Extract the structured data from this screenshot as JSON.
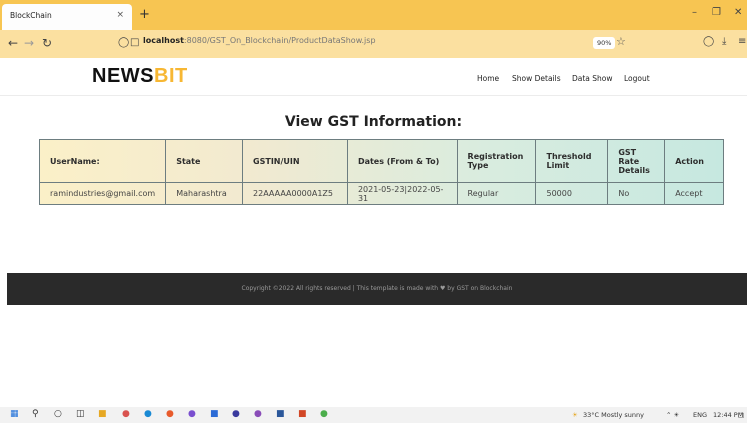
{
  "browser": {
    "tab_title": "BlockChain",
    "tab_close": "×",
    "new_tab": "+",
    "url_prefix": "localhost",
    "url_path": ":8080/GST_On_Blockchain/ProductDataShow.jsp",
    "zoom": "90%",
    "icons": [
      "back-icon",
      "forward-icon",
      "reload-icon",
      "shield-icon",
      "page-icon",
      "star-icon",
      "pocket-icon",
      "download-icon",
      "menu-icon"
    ]
  },
  "site": {
    "logo_main": "NEWS",
    "logo_accent": "BIT",
    "accent_color": "#f7b733",
    "nav": [
      "Home",
      "Show Details",
      "Data Show",
      "Logout"
    ]
  },
  "page": {
    "title": "View GST Information:"
  },
  "table": {
    "headers": [
      "UserName:",
      "State",
      "GSTIN/UIN",
      "Dates (From & To)",
      "Registration Type",
      "Threshold Limit",
      "GST Rate Details",
      "Action"
    ],
    "rows": [
      [
        "ramindustries@gmail.com",
        "Maharashtra",
        "22AAAAA0000A1Z5",
        "2021-05-23|2022-05-31",
        "Regular",
        "50000",
        "No",
        "Accept"
      ]
    ]
  },
  "footer": {
    "text": "Copyright ©2022 All rights reserved | This template is made with ♥ by GST on Blockchain"
  },
  "taskbar": {
    "weather": "33°C  Mostly sunny",
    "lang": "ENG",
    "time": "12:44 PM"
  }
}
